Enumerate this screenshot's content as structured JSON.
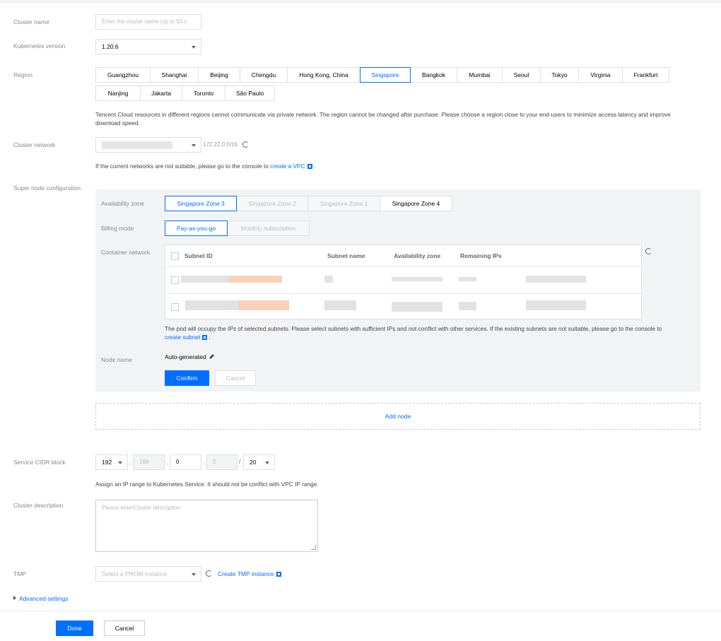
{
  "labels": {
    "cluster_name": "Cluster name",
    "k8s_version": "Kubernetes version",
    "region": "Region",
    "cluster_network": "Cluster network",
    "super_node": "Super node configuration",
    "service_cidr": "Service CIDR block",
    "cluster_description": "Cluster description",
    "tmp": "TMP"
  },
  "cluster_name": {
    "placeholder": "Enter the cluster name (up to 50 c"
  },
  "k8s_version": {
    "value": "1.20.6"
  },
  "regions": {
    "row1": [
      "Guangzhou",
      "Shanghai",
      "Beijing",
      "Chengdu",
      "Hong Kong, China",
      "Singapore",
      "Bangkok",
      "Mumbai",
      "Seoul",
      "Tokyo",
      "Virginia",
      "Frankfurt"
    ],
    "row2": [
      "Nanjing",
      "Jakarta",
      "Toronto",
      "São Paulo"
    ],
    "selected": "Singapore",
    "note": "Tencent Cloud resources in different regions cannot communicate via private network. The region cannot be changed after purchase. Please choose a region close to your end-users to minimize access latency and improve download speed."
  },
  "cluster_network": {
    "cidr": "172.22.0.0/16",
    "note_prefix": "If the current networks are not suitable, please go to the console to",
    "note_link": "create a VPC",
    "note_suffix": "."
  },
  "super_node": {
    "az_label": "Availability zone",
    "zones": [
      "Singapore Zone 3",
      "Singapore Zone 2",
      "Singapore Zone 1",
      "Singapore Zone 4"
    ],
    "billing_label": "Billing mode",
    "billing": [
      "Pay-as-you-go",
      "Monthly subscription"
    ],
    "container_network_label": "Container network",
    "table_headers": [
      "Subnet ID",
      "Subnet name",
      "Availability zone",
      "Remaining IPs"
    ],
    "subnet_note_prefix": "The pod will occupy the IPs of selected subnets. Please select subnets with sufficient IPs and not conflict with other services. If the existing subnets are not suitable, please go to the console to",
    "subnet_note_link": "create subnet",
    "subnet_note_suffix": ".",
    "node_name_label": "Node name",
    "node_name_value": "Auto-generated",
    "confirm": "Confirm",
    "cancel": "Cancel",
    "add_node": "Add node"
  },
  "service_cidr": {
    "octet1": "192",
    "octet2": "168",
    "octet3": "0",
    "octet4": "0",
    "slash": "/",
    "mask": "20",
    "note": "Assign an IP range to Kubernetes Service. It should not be conflict with VPC IP range."
  },
  "cluster_description": {
    "placeholder": "Please enterCluster description"
  },
  "tmp": {
    "placeholder": "Select a PROM instance",
    "link": "Create TMP instance"
  },
  "advanced_settings": "Advanced settings",
  "footer": {
    "done": "Done",
    "cancel": "Cancel"
  },
  "colors": {
    "primary": "#006eff",
    "border": "#dcdfe4",
    "panel_bg": "#f2f3f5"
  }
}
